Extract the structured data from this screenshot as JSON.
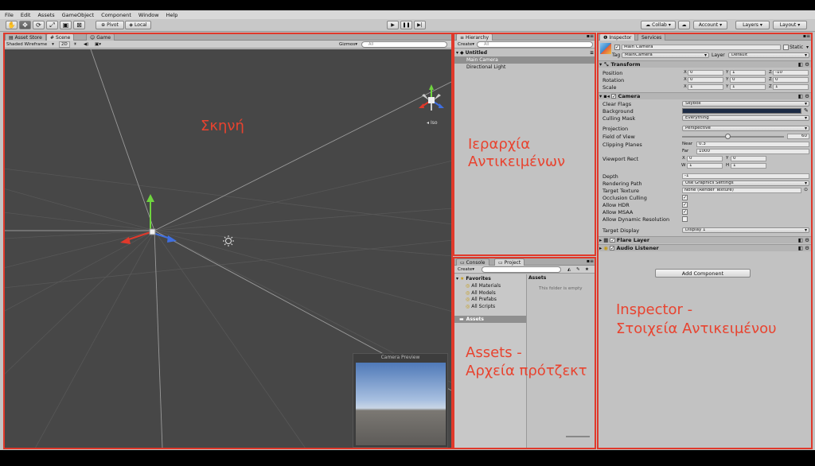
{
  "menu": [
    "File",
    "Edit",
    "Assets",
    "GameObject",
    "Component",
    "Window",
    "Help"
  ],
  "toolbar": {
    "tools": [
      {
        "name": "hand-tool-button",
        "glyph": "✋"
      },
      {
        "name": "move-tool-button",
        "glyph": "✥"
      },
      {
        "name": "rotate-tool-button",
        "glyph": "⟳"
      },
      {
        "name": "scale-tool-button",
        "glyph": "⤢"
      },
      {
        "name": "rect-tool-button",
        "glyph": "▣"
      },
      {
        "name": "transform-tool-button",
        "glyph": "⊠"
      }
    ],
    "pivot": "Pivot",
    "local": "Local",
    "collab": "Collab",
    "account": "Account",
    "layers": "Layers",
    "layout": "Layout"
  },
  "scene": {
    "tabs": [
      "Asset Store",
      "Scene",
      "Game"
    ],
    "shading": "Shaded Wireframe",
    "mode2d": "2D",
    "gizmos": "Gizmos",
    "search_placeholder": "All",
    "iso": "Iso",
    "camera_preview": "Camera Preview"
  },
  "hierarchy": {
    "tab": "Hierarchy",
    "create": "Create",
    "search_placeholder": "All",
    "root": "Untitled",
    "items": [
      "Main Camera",
      "Directional Light"
    ]
  },
  "project": {
    "tabs": [
      "Console",
      "Project"
    ],
    "create": "Create",
    "favorites": "Favorites",
    "favorite_items": [
      "All Materials",
      "All Models",
      "All Prefabs",
      "All Scripts"
    ],
    "assets": "Assets",
    "assets_header": "Assets",
    "empty": "This folder is empty"
  },
  "inspector": {
    "tabs": [
      "Inspector",
      "Services"
    ],
    "object_name": "Main Camera",
    "static": "Static",
    "tag_label": "Tag",
    "tag": "MainCamera",
    "layer_label": "Layer",
    "layer": "Default",
    "transform": {
      "title": "Transform",
      "rows": [
        {
          "label": "Position",
          "x": "0",
          "y": "1",
          "z": "-10"
        },
        {
          "label": "Rotation",
          "x": "0",
          "y": "0",
          "z": "0"
        },
        {
          "label": "Scale",
          "x": "1",
          "y": "1",
          "z": "1"
        }
      ]
    },
    "camera": {
      "title": "Camera",
      "clear_flags_label": "Clear Flags",
      "clear_flags": "Skybox",
      "background_label": "Background",
      "background_color": "#1c2b45",
      "culling_mask_label": "Culling Mask",
      "culling_mask": "Everything",
      "projection_label": "Projection",
      "projection": "Perspective",
      "fov_label": "Field of View",
      "fov": "60",
      "fov_slider_fraction": 0.45,
      "clipping_label": "Clipping Planes",
      "near_label": "Near",
      "near": "0.3",
      "far_label": "Far",
      "far": "1000",
      "viewport_label": "Viewport Rect",
      "vx": "0",
      "vy": "0",
      "vw": "1",
      "vh": "1",
      "depth_label": "Depth",
      "depth": "-1",
      "rendering_path_label": "Rendering Path",
      "rendering_path": "Use Graphics Settings",
      "target_texture_label": "Target Texture",
      "target_texture": "None (Render Texture)",
      "occlusion_label": "Occlusion Culling",
      "hdr_label": "Allow HDR",
      "msaa_label": "Allow MSAA",
      "dyn_res_label": "Allow Dynamic Resolution",
      "target_display_label": "Target Display",
      "target_display": "Display 1"
    },
    "flare_layer": "Flare Layer",
    "audio_listener": "Audio Listener",
    "add_component": "Add Component"
  },
  "overlays": {
    "scene": "Σκηνή",
    "hierarchy_line1": "Ιεραρχία",
    "hierarchy_line2": "Αντικειμένων",
    "assets_line1": "Assets -",
    "assets_line2": "Αρχεία πρότζεκτ",
    "inspector_line1": "Inspector -",
    "inspector_line2": "Στοιχεία Αντικειμένου"
  },
  "colors": {
    "annotation_red": "#e0392b",
    "scene_bg": "#474747",
    "selection": "#8f8f8f"
  }
}
